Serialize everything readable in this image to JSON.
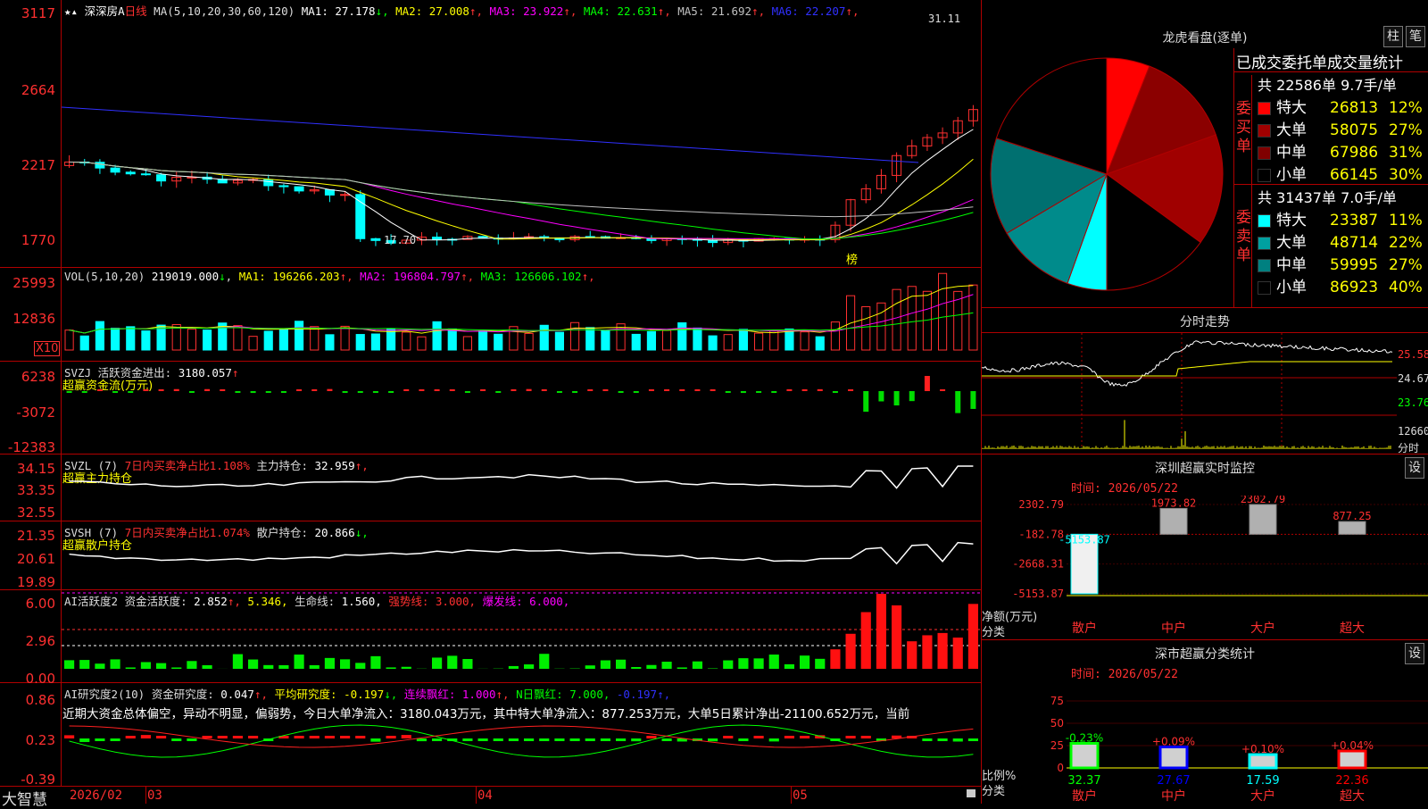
{
  "stock": {
    "name": "深深房A",
    "period": "日线",
    "icons": [
      "star-icon",
      "triangle-up-icon"
    ]
  },
  "ma_header": {
    "label": "MA(5,10,20,30,60,120)",
    "items": [
      {
        "k": "MA1",
        "v": "27.178",
        "arrow": "↓",
        "color": "#ffffff"
      },
      {
        "k": "MA2",
        "v": "27.008",
        "arrow": "↑",
        "color": "#ffff00"
      },
      {
        "k": "MA3",
        "v": "23.922",
        "arrow": "↑",
        "color": "#ff00ff"
      },
      {
        "k": "MA4",
        "v": "22.631",
        "arrow": "↑",
        "color": "#00ff00"
      },
      {
        "k": "MA5",
        "v": "21.692",
        "arrow": "↑",
        "color": "#c0c0c0"
      },
      {
        "k": "MA6",
        "v": "22.207",
        "arrow": "↑",
        "color": "#3030ff"
      }
    ]
  },
  "price_axis": [
    "3117",
    "2664",
    "2217",
    "1770"
  ],
  "price_annot": {
    "high": "31.11",
    "low": "17.70",
    "badge": "榜"
  },
  "vol_header": {
    "label": "VOL(5,10,20)",
    "v": "219019.000",
    "arrow": "↓",
    "ma": [
      {
        "k": "MA1",
        "v": "196266.203",
        "arrow": "↑",
        "color": "#ffff00"
      },
      {
        "k": "MA2",
        "v": "196804.797",
        "arrow": "↑",
        "color": "#ff00ff"
      },
      {
        "k": "MA3",
        "v": "126606.102",
        "arrow": "↑",
        "color": "#00ff00"
      }
    ]
  },
  "vol_axis": [
    "25993",
    "12836"
  ],
  "vol_unit": "X10",
  "svzj": {
    "label": "SVZJ",
    "title": "活跃资金进出:",
    "v": "3180.057",
    "arrow": "↑",
    "sub": "超赢资金流(万元)",
    "axis": [
      "6238",
      "-3072",
      "-12383"
    ]
  },
  "svzl": {
    "label": "SVZL (7)",
    "ratio": "7日内买卖净占比1.108%",
    "title": "主力持仓:",
    "v": "32.959",
    "arrow": "↑,",
    "sub": "超赢主力持仓",
    "axis": [
      "34.15",
      "33.35",
      "32.55"
    ]
  },
  "svsh": {
    "label": "SVSH (7)",
    "ratio": "7日内买卖净占比1.074%",
    "title": "散户持仓:",
    "v": "20.866",
    "arrow": "↓,",
    "sub": "超赢散户持仓",
    "axis": [
      "21.35",
      "20.61",
      "19.89"
    ]
  },
  "ai1": {
    "label": "AI活跃度2",
    "t1": "资金活跃度:",
    "v1": "2.852",
    "a1": "↑,",
    "v2": "5.346,",
    "t3": "生命线:",
    "v3": "1.560,",
    "t4": "强势线:",
    "v4": "3.000,",
    "t5": "爆发线:",
    "v5": "6.000,",
    "axis": [
      "6.00",
      "2.96",
      "0.00"
    ]
  },
  "ai2": {
    "label": "AI研究度2(10)",
    "t1": "资金研究度:",
    "v1": "0.047",
    "a1": "↑,",
    "t2": "平均研究度:",
    "v2": "-0.197",
    "a2": "↓,",
    "t3": "连续飘红:",
    "v3": "1.000",
    "a3": "↑,",
    "t4": "N日飘红:",
    "v4": "7.000,",
    "v5": "-0.197",
    "a5": "↑,",
    "text": "近期大资金总体偏空，异动不明显，偏弱势，今日大单净流入：3180.043万元，其中特大单净流入：877.253万元，大单5日累计净出-21100.652万元，当前",
    "axis": [
      "0.86",
      "0.23",
      "-0.39"
    ]
  },
  "date_axis": {
    "brand": "大智慧",
    "labels": [
      "2026/02",
      "03",
      "04",
      "05"
    ]
  },
  "lhb": {
    "title": "龙虎看盘(逐单)",
    "btn1": "柱",
    "btn2": "笔",
    "table_title": "已成交委托单成交量统计",
    "buy": {
      "side": "委买单",
      "summary": "共 22586单 9.7手/单",
      "rows": [
        {
          "k": "特大",
          "v": "26813",
          "p": "12%",
          "c": "#ff0000"
        },
        {
          "k": "大单",
          "v": "58075",
          "p": "27%",
          "c": "#a00000"
        },
        {
          "k": "中单",
          "v": "67986",
          "p": "31%",
          "c": "#800000"
        },
        {
          "k": "小单",
          "v": "66145",
          "p": "30%",
          "c": "#000000"
        }
      ]
    },
    "sell": {
      "side": "委卖单",
      "summary": "共 31437单 7.0手/单",
      "rows": [
        {
          "k": "特大",
          "v": "23387",
          "p": "11%",
          "c": "#00ffff"
        },
        {
          "k": "大单",
          "v": "48714",
          "p": "22%",
          "c": "#00a0a0"
        },
        {
          "k": "中单",
          "v": "59995",
          "p": "27%",
          "c": "#008080"
        },
        {
          "k": "小单",
          "v": "86923",
          "p": "40%",
          "c": "#000000"
        }
      ]
    },
    "pie": [
      {
        "v": 12,
        "c": "#ff0000"
      },
      {
        "v": 27,
        "c": "#8b0000"
      },
      {
        "v": 31,
        "c": "#a00000"
      },
      {
        "v": 30,
        "c": "#000000"
      },
      {
        "v": 11,
        "c": "#00ffff"
      },
      {
        "v": 22,
        "c": "#008b8b"
      },
      {
        "v": 27,
        "c": "#007070"
      },
      {
        "v": 40,
        "c": "#000000"
      }
    ]
  },
  "fenshi": {
    "title": "分时走势",
    "axis": [
      "25.58",
      "24.67",
      "23.76",
      "12660",
      "分时"
    ]
  },
  "szmon": {
    "title": "深圳超赢实时监控",
    "btn": "设",
    "time": "时间: 2026/05/22",
    "axis": [
      "2302.79",
      "-182.78",
      "-2668.31",
      "-5153.87"
    ],
    "unit1": "净额(万元)",
    "unit2": "分类",
    "cats": [
      "散户",
      "中户",
      "大户",
      "超大"
    ],
    "values": [
      "-5153.87",
      "1973.82",
      "2302.79",
      "877.25"
    ],
    "nums": [
      -5153.87,
      1973.82,
      2302.79,
      877.25
    ]
  },
  "szcls": {
    "title": "深市超赢分类统计",
    "btn": "设",
    "time": "时间: 2026/05/22",
    "axis": [
      "75",
      "50",
      "25",
      "0"
    ],
    "unit1": "比例%",
    "unit2": "分类",
    "cats": [
      "散户",
      "中户",
      "大户",
      "超大"
    ],
    "vals": [
      "32.37",
      "27.67",
      "17.59",
      "22.36"
    ],
    "chg": [
      "-0.23%",
      "+0.09%",
      "+0.10%",
      "+0.04%"
    ],
    "nums": [
      32.37,
      27.67,
      17.59,
      22.36
    ],
    "colors": [
      "#00ff00",
      "#0000ff",
      "#00ffff",
      "#ff0000"
    ]
  }
}
